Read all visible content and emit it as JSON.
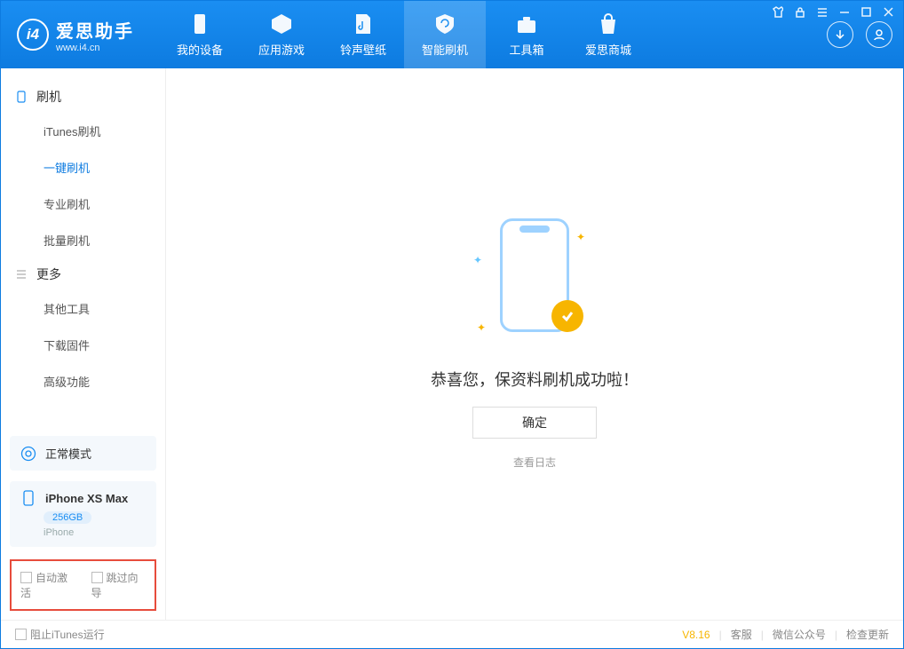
{
  "header": {
    "brand": "爱思助手",
    "url": "www.i4.cn",
    "nav": [
      {
        "label": "我的设备"
      },
      {
        "label": "应用游戏"
      },
      {
        "label": "铃声壁纸"
      },
      {
        "label": "智能刷机"
      },
      {
        "label": "工具箱"
      },
      {
        "label": "爱思商城"
      }
    ]
  },
  "sidebar": {
    "group_flash_title": "刷机",
    "flash_items": [
      {
        "label": "iTunes刷机"
      },
      {
        "label": "一键刷机"
      },
      {
        "label": "专业刷机"
      },
      {
        "label": "批量刷机"
      }
    ],
    "group_more_title": "更多",
    "more_items": [
      {
        "label": "其他工具"
      },
      {
        "label": "下载固件"
      },
      {
        "label": "高级功能"
      }
    ],
    "mode_label": "正常模式",
    "device": {
      "name": "iPhone XS Max",
      "capacity": "256GB",
      "type": "iPhone"
    },
    "options": {
      "auto_activate": "自动激活",
      "skip_guide": "跳过向导"
    }
  },
  "main": {
    "headline": "恭喜您，保资料刷机成功啦！",
    "ok_label": "确定",
    "log_link": "查看日志"
  },
  "footer": {
    "block_itunes": "阻止iTunes运行",
    "version": "V8.16",
    "links": {
      "support": "客服",
      "wechat": "微信公众号",
      "update": "检查更新"
    }
  }
}
